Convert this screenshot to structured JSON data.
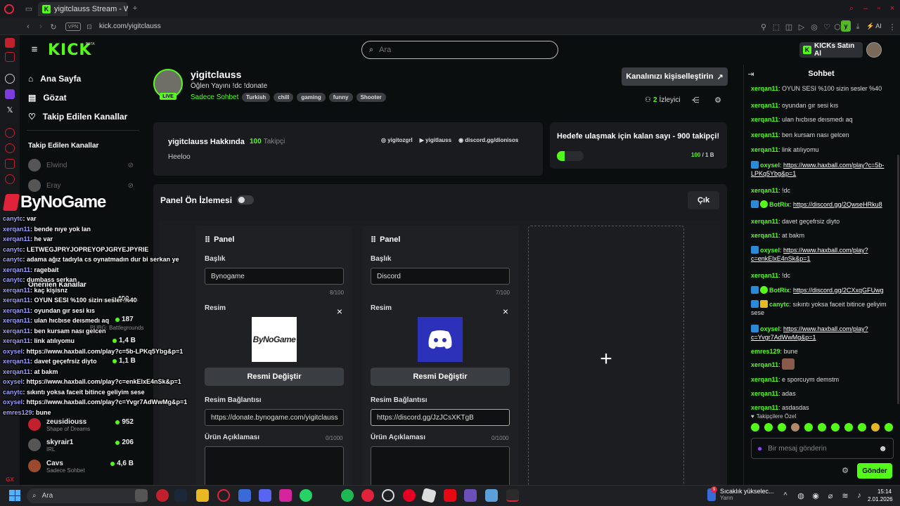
{
  "browser": {
    "tab_title": "yigitclauss Stream - Watch",
    "url": "kick.com/yigitclauss",
    "vpn": "VPN",
    "profile_letter": "y",
    "ai_label": "AI"
  },
  "header": {
    "logo": "KICK",
    "beta": "BETA",
    "search_placeholder": "Ara",
    "kicks_button": "KICKs Satın Al"
  },
  "nav": {
    "items": [
      {
        "label": "Ana Sayfa",
        "icon": "home-icon"
      },
      {
        "label": "Gözat",
        "icon": "browse-icon"
      },
      {
        "label": "Takip Edilen Kanallar",
        "icon": "heart-icon"
      }
    ],
    "followed_title": "Takip Edilen Kanallar",
    "followed": [
      "Elwind",
      "Eray"
    ],
    "recommended_title": "Önerilen Kanallar",
    "recommended": [
      {
        "name": "zeusidiouss",
        "category": "Shape of Dreams",
        "count": "952"
      },
      {
        "name": "skyrair1",
        "category": "IRL",
        "count": "206"
      },
      {
        "name": "Cavs",
        "category": "Sadece Sohbet",
        "count": "4,6 B"
      }
    ],
    "hidden_counts": [
      "1,4 B",
      "1,1 B",
      "187",
      "400"
    ],
    "hidden_categories": [
      "League of Legends",
      "PUBG: Battlegrounds"
    ]
  },
  "channel": {
    "name": "yigitclauss",
    "live_badge": "LIVE",
    "title": "Öğlen Yayını !dc !donate",
    "category": "Sadece Sohbet",
    "tags": [
      "Turkish",
      "chill",
      "gaming",
      "funny",
      "Shooter"
    ],
    "customize_button": "Kanalınızı kişiselleştirin",
    "viewers": "2",
    "viewers_label": "İzleyici"
  },
  "about": {
    "title": "yigitclauss Hakkında",
    "followers": "100",
    "followers_label": "Takipçi",
    "bio": "Heeloo",
    "socials": [
      {
        "icon": "instagram-icon",
        "label": "yigitozgrl"
      },
      {
        "icon": "youtube-icon",
        "label": "yigitlauss"
      },
      {
        "icon": "discord-icon",
        "label": "discord.gg/dionisos"
      }
    ]
  },
  "goal": {
    "title": "Hedefe ulaşmak için kalan sayı - 900 takipçi!",
    "current": "100",
    "target": "1 B",
    "progress": 0.1
  },
  "panel_editor": {
    "title": "Panel Ön İzlemesi",
    "toggle_on": false,
    "exit_button": "Çık",
    "panels": [
      {
        "header": "Panel",
        "title_label": "Başlık",
        "title_value": "Bynogame",
        "title_count": "8/100",
        "image_label": "Resim",
        "image_logo": "ByNoGame",
        "change_button": "Resmi Değiştir",
        "link_label": "Resim Bağlantısı",
        "link_value": "https://donate.bynogame.com/yigitclauss",
        "desc_label": "Ürün Açıklaması",
        "desc_count": "0/1000"
      },
      {
        "header": "Panel",
        "title_label": "Başlık",
        "title_value": "Discord",
        "title_count": "7/100",
        "image_label": "Resim",
        "change_button": "Resmi Değiştir",
        "link_label": "Resim Bağlantısı",
        "link_value": "https://discord.gg/JzJCsXKTgB",
        "desc_label": "Ürün Açıklaması",
        "desc_count": "0/1000"
      }
    ],
    "add_icon": "plus-icon"
  },
  "chat": {
    "title": "Sohbet",
    "messages": [
      {
        "user": "xerqan11",
        "text": "OYUN SESI %100 sizin sesler %40"
      },
      {
        "user": "xerqan11",
        "text": "oyundan gır sesi kıs"
      },
      {
        "user": "xerqan11",
        "text": "ulan hıcbıse deısmedı aq"
      },
      {
        "user": "xerqan11",
        "text": "ben kursam nası gelcen"
      },
      {
        "user": "xerqan11",
        "text": "link atılıyomu"
      },
      {
        "user": "oxysel",
        "text": "https://www.haxball.com/play?c=5b-LPKq5Ybg&p=1",
        "link": true,
        "badges": [
          "blue"
        ]
      },
      {
        "user": "xerqan11",
        "text": "!dc"
      },
      {
        "user": "BotRix",
        "text": "https://discord.gg/2QwseHRku8",
        "link": true,
        "badges": [
          "blue",
          "green"
        ]
      },
      {
        "user": "xerqan11",
        "text": "davet geçefrsiz diyto"
      },
      {
        "user": "xerqan11",
        "text": "at bakm"
      },
      {
        "user": "oxysel",
        "text": "https://www.haxball.com/play?c=enkElxE4nSk&p=1",
        "link": true,
        "badges": [
          "blue"
        ]
      },
      {
        "user": "xerqan11",
        "text": "!dc"
      },
      {
        "user": "BotRix",
        "text": "https://discord.gg/2CXxqGFUwg",
        "link": true,
        "badges": [
          "blue",
          "green"
        ]
      },
      {
        "user": "canytc",
        "text": "sıkıntı yoksa faceit bitince geliyim sese",
        "badges": [
          "blue",
          "yellow"
        ]
      },
      {
        "user": "oxysel",
        "text": "https://www.haxball.com/play?c=Yvgr7AdWwMg&p=1",
        "link": true,
        "badges": [
          "blue"
        ]
      },
      {
        "user": "emres129",
        "text": "bune"
      },
      {
        "user": "xerqan11",
        "text": "",
        "emote": true
      },
      {
        "user": "xerqan11",
        "text": "e sporcuym demstm"
      },
      {
        "user": "xerqan11",
        "text": "adas"
      },
      {
        "user": "xerqan11",
        "text": "asdasdas"
      }
    ],
    "followers_only": "Takipçilere Özel",
    "input_placeholder": "Bir mesaj gönderin",
    "send_button": "Gönder"
  },
  "overlay": {
    "logo": "ByNoGame",
    "lines": [
      {
        "user": "canytc",
        "text": "var"
      },
      {
        "user": "xerqan11",
        "text": "bende nıye yok lan"
      },
      {
        "user": "xerqan11",
        "text": "he var"
      },
      {
        "user": "canytc",
        "text": "LETWEGJPRYJOPREYOPJGRYEJPYRIE"
      },
      {
        "user": "canytc",
        "text": "adama ağız tadıyla cs oynatmadın dur bi serkan ye"
      },
      {
        "user": "xerqan11",
        "text": "ragebait"
      },
      {
        "user": "canytc",
        "text": "dumbass serkan"
      },
      {
        "user": "xerqan11",
        "text": "kaç kişisnz"
      },
      {
        "user": "xerqan11",
        "text": "OYUN SESI %100 sizin sesler %40"
      },
      {
        "user": "xerqan11",
        "text": "oyundan gır sesi kıs"
      },
      {
        "user": "xerqan11",
        "text": "ulan hıcbıse deısmedı aq"
      },
      {
        "user": "xerqan11",
        "text": "ben kursam nası gelcen"
      },
      {
        "user": "xerqan11",
        "text": "link atılıyomu"
      },
      {
        "user": "oxysel",
        "text": "https://www.haxball.com/play?c=5b-LPKq5Ybg&p=1"
      },
      {
        "user": "xerqan11",
        "text": "davet geçefrsiz diyto"
      },
      {
        "user": "xerqan11",
        "text": "at bakm"
      },
      {
        "user": "oxysel",
        "text": "https://www.haxball.com/play?c=enkElxE4nSk&p=1"
      },
      {
        "user": "canytc",
        "text": "sıkıntı yoksa faceit bitince geliyim sese"
      },
      {
        "user": "oxysel",
        "text": "https://www.haxball.com/play?c=Yvgr7AdWwMg&p=1"
      },
      {
        "user": "emres129",
        "text": "bune"
      }
    ]
  },
  "taskbar": {
    "search_placeholder": "Ara",
    "weather_title": "Sıcaklık yükselec...",
    "weather_sub": "Yarın",
    "time": "15:14",
    "date": "2.01.2026",
    "notification_count": "9"
  },
  "colors": {
    "accent": "#53fc18",
    "background": "#0b0e0f",
    "card": "#191b1f"
  }
}
